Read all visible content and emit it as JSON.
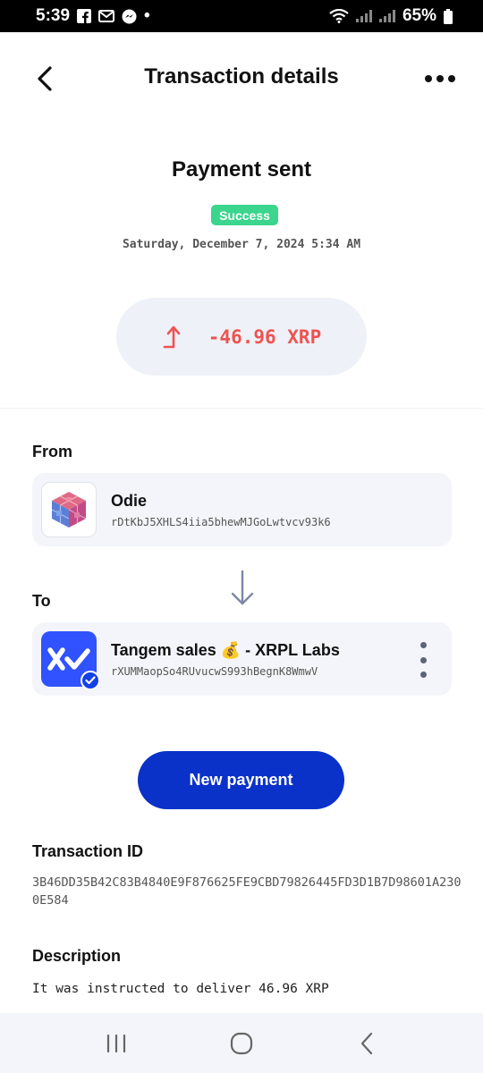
{
  "status_bar": {
    "time": "5:39",
    "dot": "•",
    "battery": "65%"
  },
  "header": {
    "title": "Transaction details"
  },
  "payment": {
    "title": "Payment sent",
    "status": "Success",
    "date": "Saturday, December 7, 2024 5:34 AM",
    "amount": "-46.96 XRP"
  },
  "from": {
    "label": "From",
    "name": "Odie",
    "address": "rDtKbJ5XHLS4iia5bhewMJGoLwtvcv93k6"
  },
  "to": {
    "label": "To",
    "name": "Tangem sales 💰 - XRPL Labs",
    "address": "rXUMMaopSo4RUvucwS993hBegnK8WmwV"
  },
  "actions": {
    "new_payment": "New payment"
  },
  "transaction": {
    "label": "Transaction ID",
    "id": "3B46DD35B42C83B4840E9F876625FE9CBD79826445FD3D1B7D98601A2300E584"
  },
  "description": {
    "label": "Description",
    "text": "It was instructed to deliver 46.96 XRP"
  },
  "colors": {
    "accent": "#0a31c8",
    "success": "#3bd58d",
    "negative": "#ef5350"
  }
}
